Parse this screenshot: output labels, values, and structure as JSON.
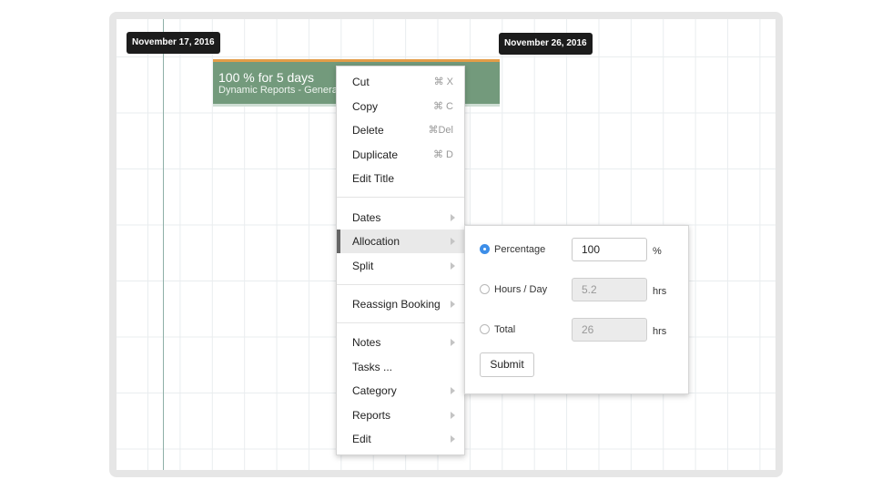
{
  "timeline": {
    "start_date_tag": "November 17, 2016",
    "end_date_tag": "November 26, 2016"
  },
  "booking": {
    "title": "100 % for 5 days",
    "subtitle": "Dynamic Reports - General"
  },
  "context_menu": {
    "cut": {
      "label": "Cut",
      "shortcut": "⌘ X"
    },
    "copy": {
      "label": "Copy",
      "shortcut": "⌘ C"
    },
    "delete": {
      "label": "Delete",
      "shortcut": "⌘Del"
    },
    "duplicate": {
      "label": "Duplicate",
      "shortcut": "⌘ D"
    },
    "edit_title": {
      "label": "Edit Title"
    },
    "dates": {
      "label": "Dates"
    },
    "allocation": {
      "label": "Allocation"
    },
    "split": {
      "label": "Split"
    },
    "reassign": {
      "label": "Reassign Booking"
    },
    "notes": {
      "label": "Notes"
    },
    "tasks": {
      "label": "Tasks ..."
    },
    "category": {
      "label": "Category"
    },
    "reports": {
      "label": "Reports"
    },
    "edit": {
      "label": "Edit"
    }
  },
  "allocation_panel": {
    "percentage": {
      "label": "Percentage",
      "value": "100",
      "unit": "%",
      "selected": true
    },
    "hours_per_day": {
      "label": "Hours / Day",
      "value": "5.2",
      "unit": "hrs",
      "selected": false
    },
    "total": {
      "label": "Total",
      "value": "26",
      "unit": "hrs",
      "selected": false
    },
    "submit_label": "Submit"
  },
  "colors": {
    "booking_bar": "#739a7c",
    "booking_top_stripe": "#e39d48",
    "radio_selected": "#3d8ee8",
    "date_tag_bg": "#1c1c1c"
  }
}
